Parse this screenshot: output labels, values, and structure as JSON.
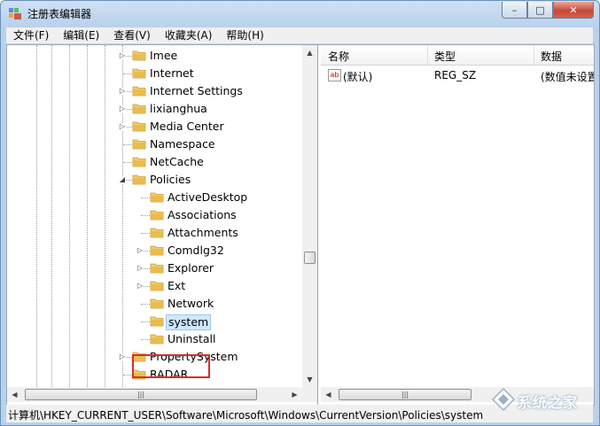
{
  "window": {
    "title": "注册表编辑器",
    "controls": {
      "minimize": "–",
      "maximize": "□",
      "close": "✕"
    }
  },
  "menu": [
    "文件(F)",
    "编辑(E)",
    "查看(V)",
    "收藏夹(A)",
    "帮助(H)"
  ],
  "tree": {
    "items": [
      {
        "label": "Imee",
        "level": 0,
        "expander": "collapsed"
      },
      {
        "label": "Internet",
        "level": 0,
        "expander": "none"
      },
      {
        "label": "Internet Settings",
        "level": 0,
        "expander": "collapsed"
      },
      {
        "label": "lixianghua",
        "level": 0,
        "expander": "collapsed"
      },
      {
        "label": "Media Center",
        "level": 0,
        "expander": "collapsed"
      },
      {
        "label": "Namespace",
        "level": 0,
        "expander": "none"
      },
      {
        "label": "NetCache",
        "level": 0,
        "expander": "none"
      },
      {
        "label": "Policies",
        "level": 0,
        "expander": "expanded"
      },
      {
        "label": "ActiveDesktop",
        "level": 1,
        "expander": "none"
      },
      {
        "label": "Associations",
        "level": 1,
        "expander": "none"
      },
      {
        "label": "Attachments",
        "level": 1,
        "expander": "none"
      },
      {
        "label": "Comdlg32",
        "level": 1,
        "expander": "collapsed"
      },
      {
        "label": "Explorer",
        "level": 1,
        "expander": "collapsed"
      },
      {
        "label": "Ext",
        "level": 1,
        "expander": "collapsed"
      },
      {
        "label": "Network",
        "level": 1,
        "expander": "none"
      },
      {
        "label": "system",
        "level": 1,
        "expander": "none",
        "selected": true
      },
      {
        "label": "Uninstall",
        "level": 1,
        "expander": "none"
      },
      {
        "label": "PropertySystem",
        "level": 0,
        "expander": "collapsed"
      },
      {
        "label": "RADAR",
        "level": 0,
        "expander": "none"
      }
    ]
  },
  "list": {
    "columns": [
      "名称",
      "类型",
      "数据"
    ],
    "rows": [
      {
        "name": "(默认)",
        "type": "REG_SZ",
        "data": "(数值未设置)",
        "icon": "ab"
      }
    ]
  },
  "status": {
    "path": "计算机\\HKEY_CURRENT_USER\\Software\\Microsoft\\Windows\\CurrentVersion\\Policies\\system"
  },
  "watermark": {
    "text": "系统之家"
  },
  "colors": {
    "highlight": "#d32f2f",
    "selection": "#cde8ff",
    "folder": "#e8b84a"
  }
}
